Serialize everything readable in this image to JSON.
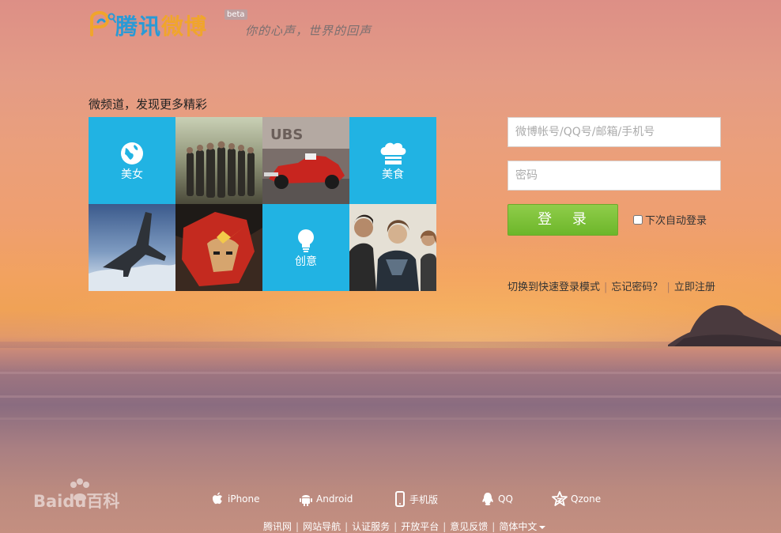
{
  "header": {
    "logo_text_a": "腾讯",
    "logo_text_b": "微博",
    "badge": "beta",
    "slogan": "你的心声，世界的回声"
  },
  "channels": {
    "title": "微频道，发现更多精彩",
    "tiles": [
      {
        "label": "美女",
        "icon": "globe-icon"
      },
      {
        "label": "美食",
        "icon": "chef-hat-icon"
      },
      {
        "label": "创意",
        "icon": "lightbulb-icon"
      }
    ]
  },
  "login": {
    "username_placeholder": "微博帐号/QQ号/邮箱/手机号",
    "password_placeholder": "密码",
    "submit_label": "登 录",
    "auto_login_label": "下次自动登录",
    "quick_login_link": "切换到快速登录模式",
    "forgot_link": "忘记密码？",
    "register_link": "立即注册"
  },
  "watermark": {
    "brand": "Baidu百科"
  },
  "apps": [
    {
      "label": "iPhone",
      "icon": "apple-icon"
    },
    {
      "label": "Android",
      "icon": "android-icon"
    },
    {
      "label": "手机版",
      "icon": "phone-icon"
    },
    {
      "label": "QQ",
      "icon": "qq-penguin-icon"
    },
    {
      "label": "Qzone",
      "icon": "qzone-star-icon"
    }
  ],
  "footer": {
    "links": [
      "腾讯网",
      "网站导航",
      "认证服务",
      "开放平台",
      "意见反馈",
      "简体中文"
    ]
  },
  "colors": {
    "tile_blue": "#21b3e3",
    "login_green": "#6db62a",
    "logo_blue": "#2a9ad6",
    "logo_orange": "#f0a52c"
  }
}
